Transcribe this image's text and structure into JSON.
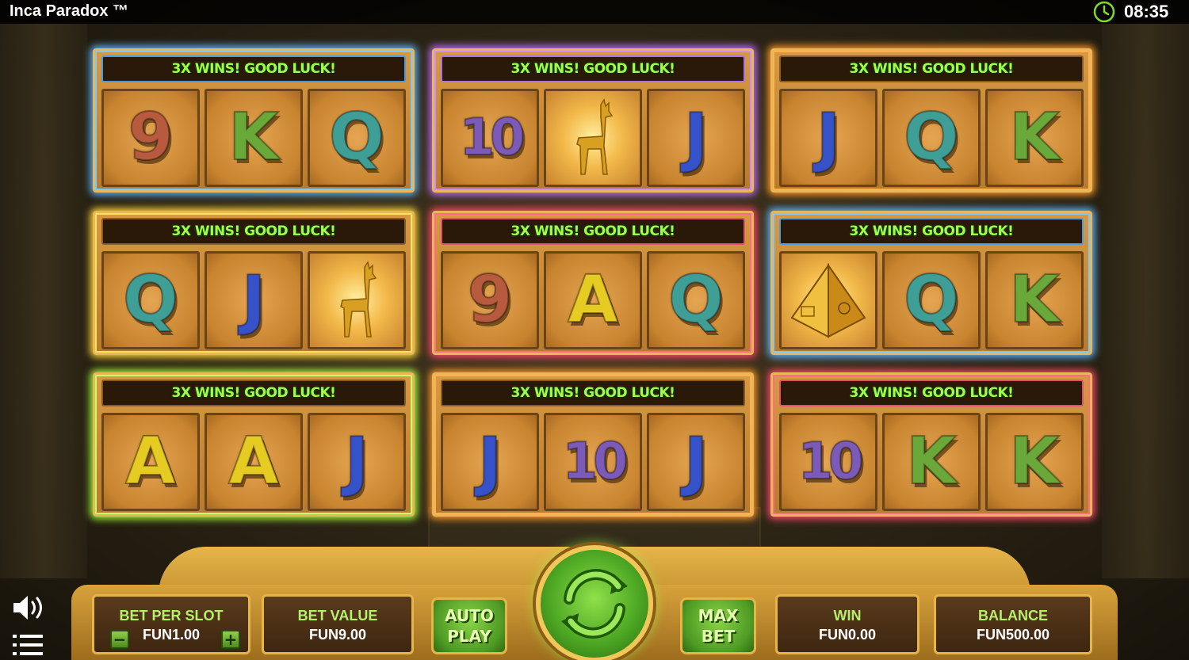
{
  "window": {
    "title": "Inca Paradox ™",
    "time": "08:35"
  },
  "banner_text": "3X WINS! GOOD LUCK!",
  "machines": [
    {
      "glow": "blue",
      "symbols": [
        "9",
        "K",
        "Q"
      ]
    },
    {
      "glow": "purple",
      "symbols": [
        "10",
        "llama",
        "J"
      ]
    },
    {
      "glow": "orange",
      "symbols": [
        "J",
        "Q",
        "K"
      ]
    },
    {
      "glow": "yellow",
      "symbols": [
        "Q",
        "J",
        "llama"
      ]
    },
    {
      "glow": "red",
      "symbols": [
        "9",
        "A",
        "Q"
      ]
    },
    {
      "glow": "blue",
      "symbols": [
        "pyramid",
        "Q",
        "K"
      ]
    },
    {
      "glow": "green",
      "symbols": [
        "A",
        "A",
        "J"
      ]
    },
    {
      "glow": "orange",
      "symbols": [
        "J",
        "10",
        "J"
      ]
    },
    {
      "glow": "red",
      "symbols": [
        "10",
        "K",
        "K"
      ]
    }
  ],
  "controls": {
    "bet_per_slot": {
      "label": "BET PER SLOT",
      "value": "FUN1.00",
      "minus": "−",
      "plus": "+"
    },
    "bet_value": {
      "label": "BET VALUE",
      "value": "FUN9.00"
    },
    "auto_play": {
      "line1": "AUTO",
      "line2": "PLAY"
    },
    "max_bet": {
      "line1": "MAX",
      "line2": "BET"
    },
    "win": {
      "label": "WIN",
      "value": "FUN0.00"
    },
    "balance": {
      "label": "BALANCE",
      "value": "FUN500.00"
    }
  },
  "icons": [
    "clock-icon",
    "sound-icon",
    "menu-icon",
    "spin-icon",
    "llama-icon",
    "pyramid-icon"
  ],
  "colors": {
    "banner_text": "#9cff4a",
    "label_green": "#b6f06a",
    "gold": "#e6b54a"
  }
}
